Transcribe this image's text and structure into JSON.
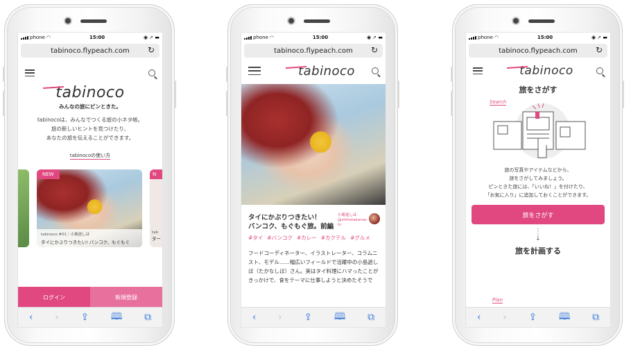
{
  "status": {
    "carrier": "phone",
    "time": "15:00",
    "right_icons": "◉ ➚ ▬"
  },
  "url": "tabinoco.flypeach.com",
  "brand": {
    "logo": "tabinoco",
    "accent": "#e0487f"
  },
  "left": {
    "tagline": "みんなの旅にピンときた。",
    "desc": [
      "tabinocoは、みんなでつくる旅の小ネタ帳。",
      "旅の新しいヒントを見つけたり、",
      "あなたの旅を伝えることができます。"
    ],
    "howto": "tabinocoの使い方",
    "card": {
      "badge": "NEW",
      "author": "tabinoco #01｜小島逝しほ",
      "title": "タイにかぶりつきたい! バンコク、もぐもぐ旅。",
      "peek_badge": "N",
      "peek_author": "tab",
      "peek_title": "ター"
    },
    "login": "ログイン",
    "signup": "新規登録"
  },
  "middle": {
    "title": "タイにかぶりつきたい！\nバンコク、もぐもぐ旅。前編",
    "author_name": "小島逝しほ",
    "author_handle": "@shihotakanas hi",
    "tags": [
      "#タイ",
      "#バンコク",
      "#カレー",
      "#カクテル",
      "#グルメ"
    ],
    "body": "フードコーディネーター、イラストレーター、コラムニスト、モデル……幅広いフィールドで活躍中の小島逝しほ（たかなしほ）さん。実はタイ料理にハマったことがきっかけで、食をテーマに仕事しようと決めたそうで"
  },
  "right": {
    "section1": "旅をさがす",
    "search_label": "Search",
    "desc": [
      "旅の写真やアイテムなどから、",
      "旅をさがしてみましょう。",
      "ピンときた旅には、「いいね！」を付けたり、",
      "「お気に入り」に追加しておくことができます。"
    ],
    "cta": "旅をさがす",
    "section2": "旅を計画する",
    "plan_label": "Plan"
  },
  "toolbar": {
    "back": "‹",
    "forward": "›",
    "share": "⇪",
    "bookmarks": "🕮",
    "tabs": "⧉"
  }
}
